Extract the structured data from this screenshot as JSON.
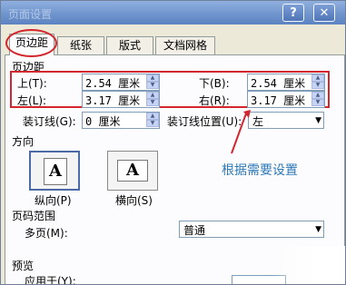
{
  "window": {
    "title": "页面设置"
  },
  "tabs": [
    "页边距",
    "纸张",
    "版式",
    "文档网格"
  ],
  "margins_section": "页边距",
  "margins": {
    "top": {
      "label": "上(T):",
      "value": "2.54 厘米"
    },
    "bottom": {
      "label": "下(B):",
      "value": "2.54 厘米"
    },
    "left": {
      "label": "左(L):",
      "value": "3.17 厘米"
    },
    "right": {
      "label": "右(R):",
      "value": "3.17 厘米"
    }
  },
  "gutter": {
    "label": "装订线(G):",
    "value": "0 厘米"
  },
  "gutter_position": {
    "label": "装订线位置(U):",
    "value": "左"
  },
  "orientation": {
    "section": "方向",
    "portrait": "纵向(P)",
    "landscape": "横向(S)",
    "glyph": "A"
  },
  "pages": {
    "section": "页码范围",
    "label": "多页(M):",
    "value": "普通"
  },
  "preview": {
    "section": "预览",
    "apply_label": "应用于(Y):"
  },
  "annotation": "根据需要设置",
  "colors": {
    "highlight": "#d4262e",
    "annotation": "#2d79b8"
  }
}
